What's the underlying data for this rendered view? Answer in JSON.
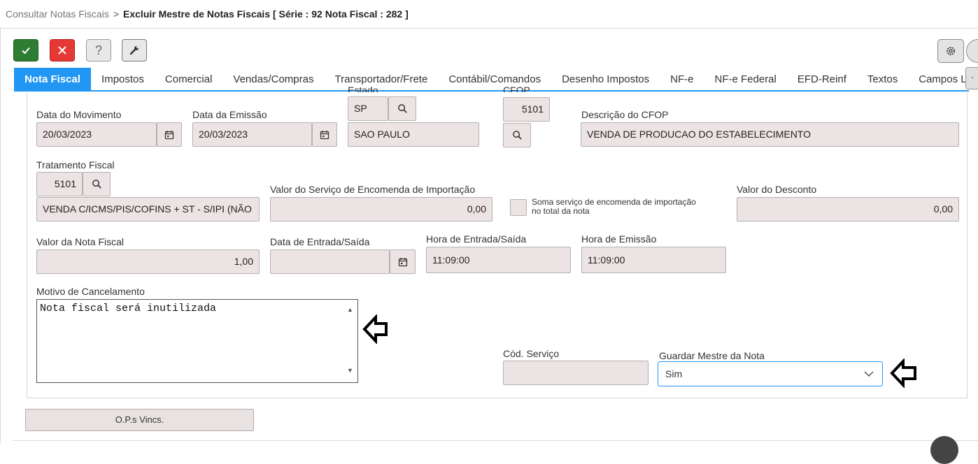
{
  "breadcrumb": {
    "parent": "Consultar Notas Fiscais",
    "separator": ">",
    "current": "Excluir Mestre de Notas Fiscais [ Série : 92 Nota Fiscal : 282 ]"
  },
  "toolbar": {
    "confirm_icon": "check-icon",
    "cancel_icon": "close-icon",
    "help_label": "?",
    "tool_icon": "wrench-icon",
    "settings_icon": "gear-icon"
  },
  "tabs": [
    {
      "label": "Nota Fiscal",
      "active": true
    },
    {
      "label": "Impostos"
    },
    {
      "label": "Comercial"
    },
    {
      "label": "Vendas/Compras"
    },
    {
      "label": "Transportador/Frete"
    },
    {
      "label": "Contábil/Comandos"
    },
    {
      "label": "Desenho Impostos"
    },
    {
      "label": "NF-e"
    },
    {
      "label": "NF-e Federal"
    },
    {
      "label": "EFD-Reinf"
    },
    {
      "label": "Textos"
    },
    {
      "label": "Campos L"
    }
  ],
  "tabs_more_label": "·",
  "form": {
    "estado_label": "Estado",
    "uf": "SP",
    "estado_nome": "SAO PAULO",
    "cfop_label": "CFOP",
    "cfop": "5101",
    "descricao_cfop_label": "Descrição do CFOP",
    "descricao_cfop": "VENDA DE PRODUCAO DO ESTABELECIMENTO",
    "data_movimento_label": "Data do Movimento",
    "data_movimento": "20/03/2023",
    "data_emissao_label": "Data da Emissão",
    "data_emissao": "20/03/2023",
    "tratamento_fiscal_label": "Tratamento Fiscal",
    "tratamento_fiscal_codigo": "5101",
    "tratamento_fiscal_desc": "VENDA C/ICMS/PIS/COFINS + ST - S/IPI (NÃO",
    "valor_servico_label": "Valor do Serviço de Encomenda de Importação",
    "valor_servico": "0,00",
    "soma_servico_label_1": "Soma serviço de encomenda de importação",
    "soma_servico_label_2": "no total da nota",
    "valor_desconto_label": "Valor do Desconto",
    "valor_desconto": "0,00",
    "valor_nota_label": "Valor da Nota Fiscal",
    "valor_nota": "1,00",
    "data_entrada_saida_label": "Data de Entrada/Saída",
    "data_entrada_saida": "",
    "hora_entrada_saida_label": "Hora de Entrada/Saída",
    "hora_entrada_saida": "11:09:00",
    "hora_emissao_label": "Hora de Emissão",
    "hora_emissao": "11:09:00",
    "motivo_label": "Motivo de Cancelamento",
    "motivo": "Nota fiscal será inutilizada",
    "cod_servico_label": "Cód. Serviço",
    "cod_servico": "",
    "guardar_mestre_label": "Guardar Mestre da Nota",
    "guardar_mestre": "Sim"
  },
  "ops_button_label": "O.P.s Vincs."
}
